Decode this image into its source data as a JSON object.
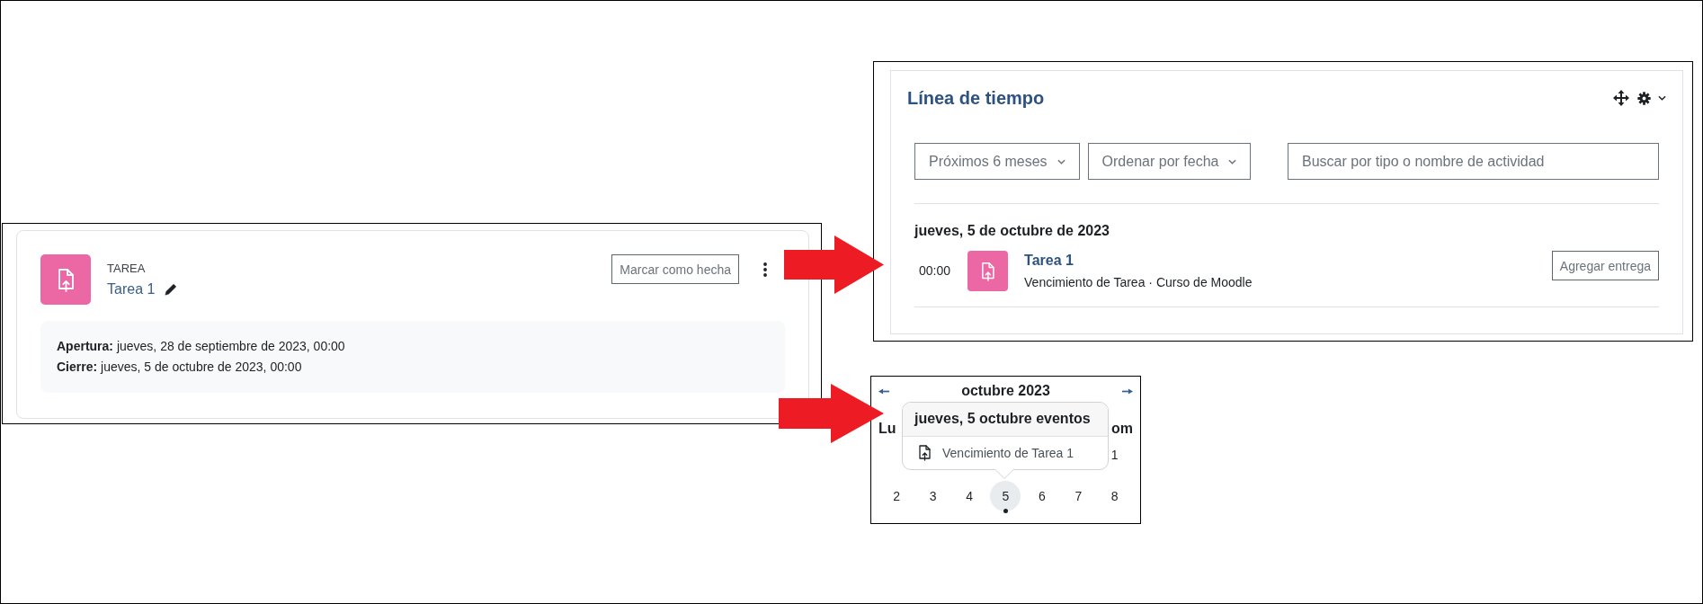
{
  "activity_card": {
    "type_label": "TAREA",
    "name": "Tarea 1",
    "complete_button": "Marcar como hecha",
    "dates": [
      "**Apertura:** jueves, 28 de septiembre de 2023, 00:00",
      "**Cierre:** jueves, 5 de octubre de 2023, 00:00"
    ]
  },
  "timeline": {
    "title": "Línea de tiempo",
    "filters": [
      "Próximos 6 meses",
      "Ordenar por fecha"
    ],
    "search": {
      "placeholder": "Buscar por tipo o nombre de actividad"
    },
    "groups": [
      {
        "date": "jueves, 5 de octubre de 2023",
        "events": [
          {
            "time": "00:00",
            "name": "Tarea 1",
            "details": "Vencimiento de Tarea · Curso de Moodle",
            "action": "Agregar entrega"
          }
        ]
      }
    ]
  },
  "calendar": {
    "month": "octubre 2023",
    "weekdays": [
      "Lu",
      "om"
    ],
    "weeks": [
      {
        "kind": "partial",
        "days": [
          {
            "day": "1",
            "selected": false,
            "has_event": false
          }
        ]
      },
      {
        "kind": "full",
        "days": [
          {
            "day": "2",
            "selected": false,
            "has_event": false
          },
          {
            "day": "3",
            "selected": false,
            "has_event": false
          },
          {
            "day": "4",
            "selected": false,
            "has_event": false
          },
          {
            "day": "5",
            "selected": true,
            "has_event": true
          },
          {
            "day": "6",
            "selected": false,
            "has_event": false
          },
          {
            "day": "7",
            "selected": false,
            "has_event": false
          },
          {
            "day": "8",
            "selected": false,
            "has_event": false
          }
        ]
      }
    ],
    "popover": {
      "title": "jueves, 5 octubre eventos",
      "events": [
        "Vencimiento de Tarea 1"
      ]
    }
  }
}
